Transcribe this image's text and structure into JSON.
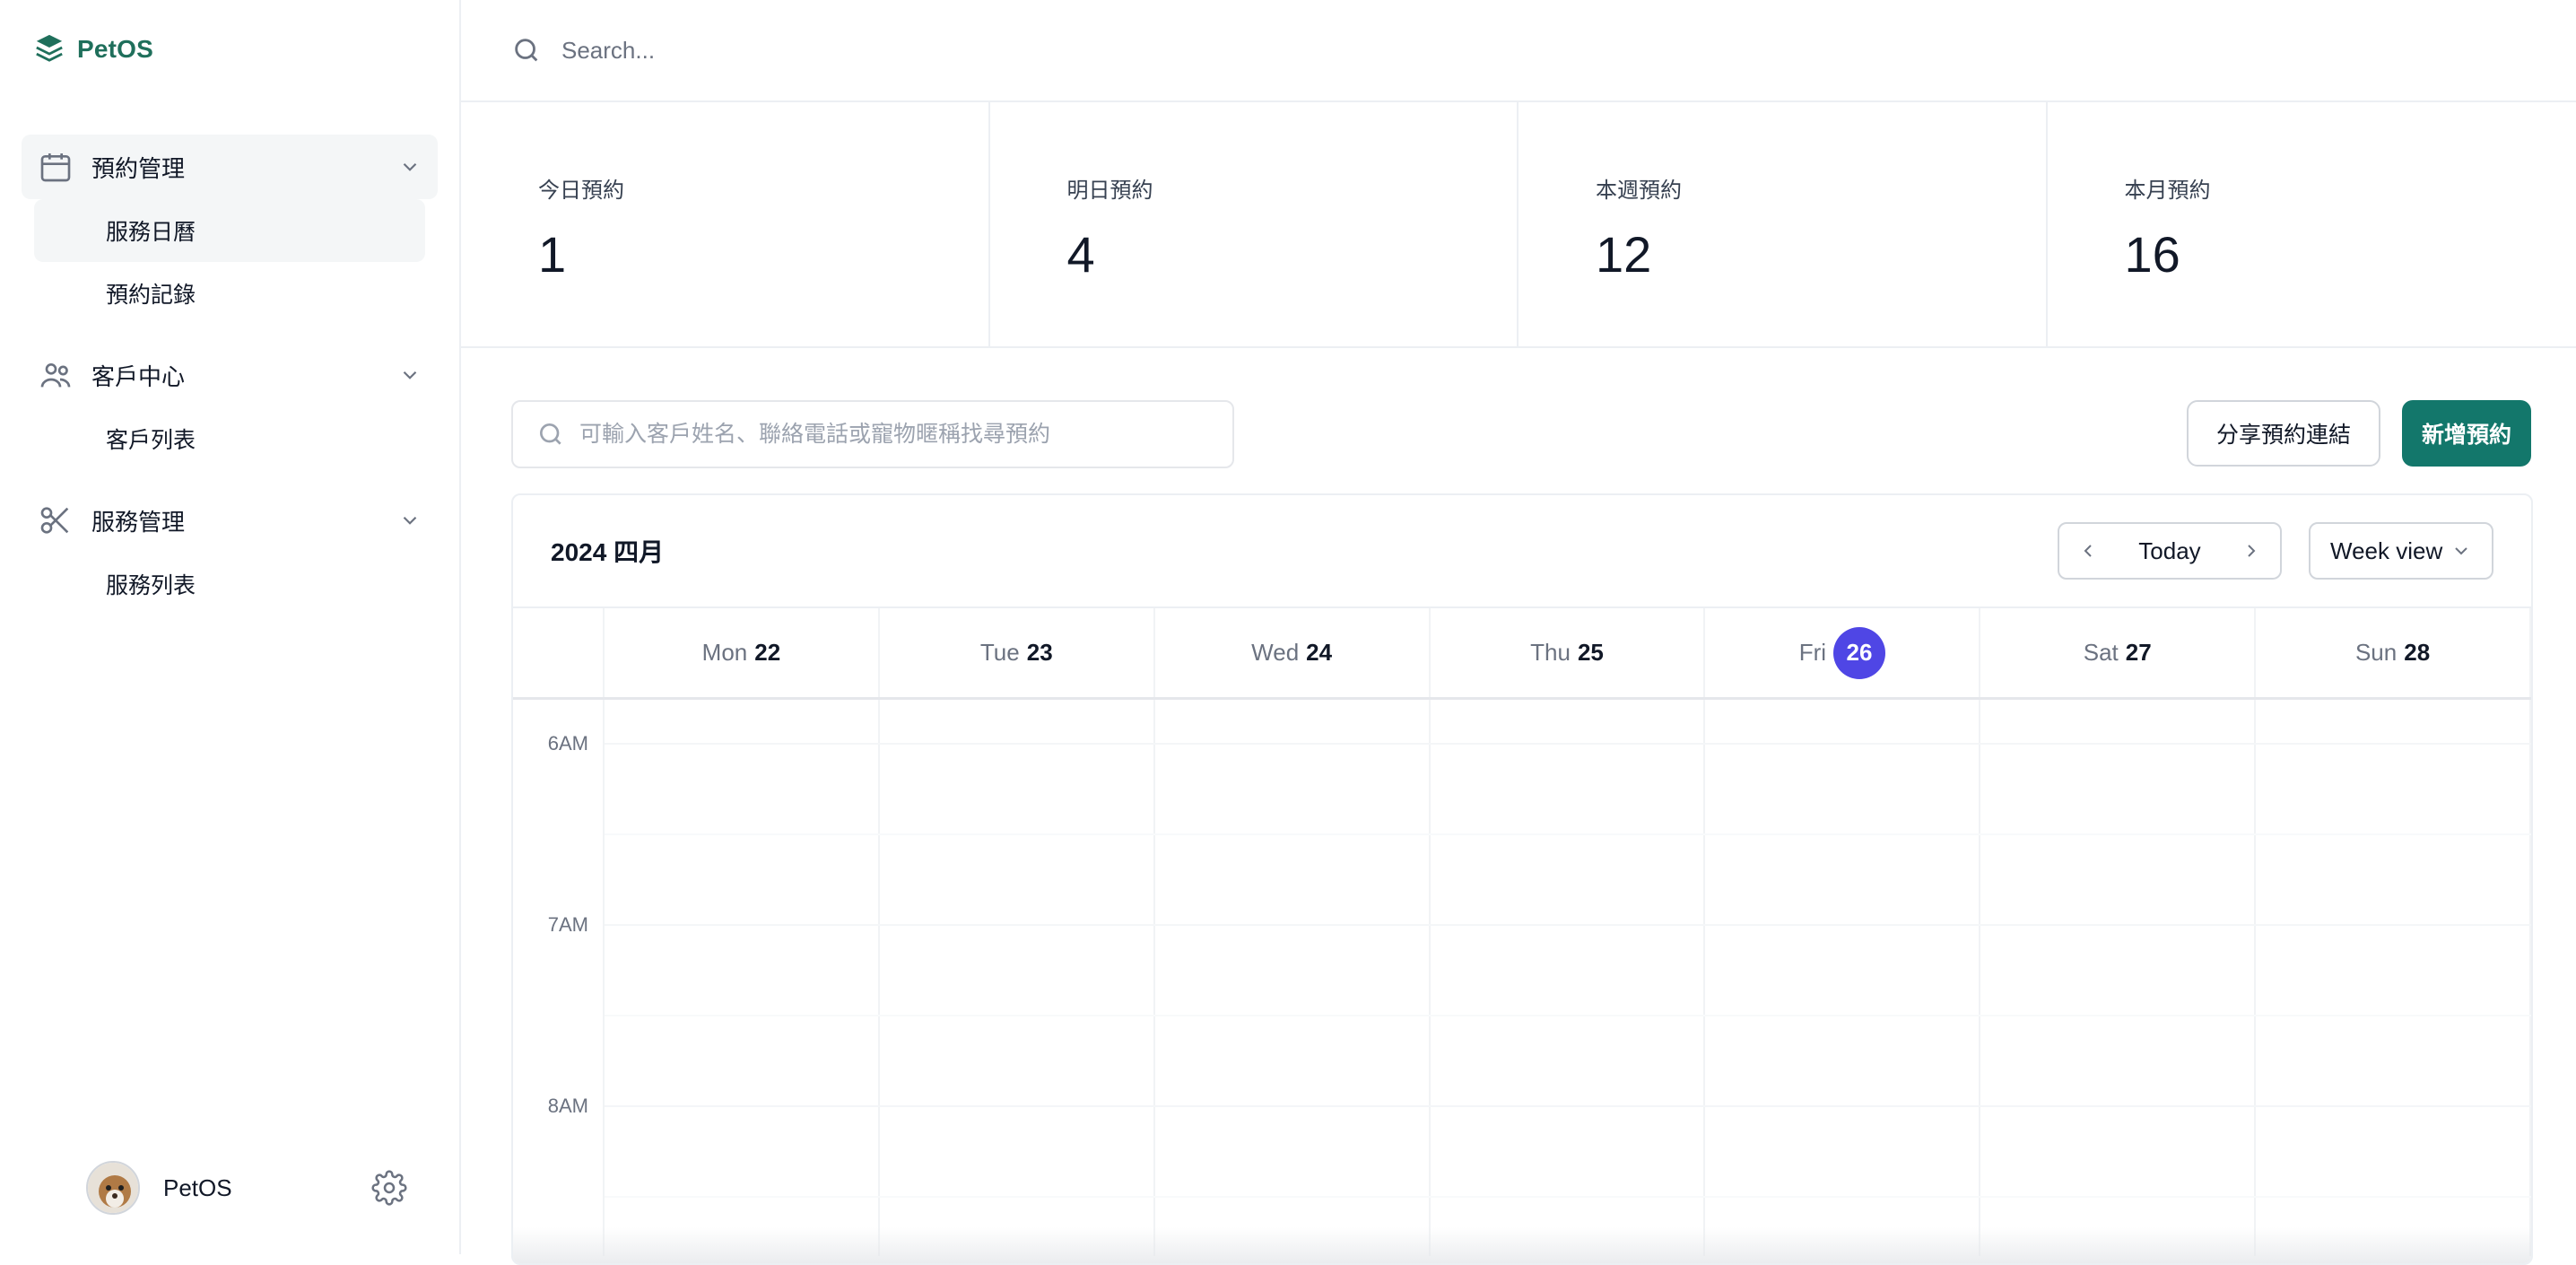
{
  "brand": {
    "name": "PetOS",
    "color": "#1f6f5b"
  },
  "top_search": {
    "placeholder": "Search..."
  },
  "sidebar": {
    "groups": [
      {
        "label": "預約管理",
        "items": [
          "服務日曆",
          "預約記錄"
        ]
      },
      {
        "label": "客戶中心",
        "items": [
          "客戶列表"
        ]
      },
      {
        "label": "服務管理",
        "items": [
          "服務列表"
        ]
      }
    ],
    "active_item": "服務日曆",
    "footer": {
      "name": "PetOS"
    }
  },
  "stats": [
    {
      "label": "今日預約",
      "value": "1"
    },
    {
      "label": "明日預約",
      "value": "4"
    },
    {
      "label": "本週預約",
      "value": "12"
    },
    {
      "label": "本月預約",
      "value": "16"
    }
  ],
  "appointment_search": {
    "placeholder": "可輸入客戶姓名、聯絡電話或寵物暱稱找尋預約"
  },
  "actions": {
    "share_label": "分享預約連結",
    "new_label": "新增預約",
    "primary_color": "#13776b"
  },
  "calendar": {
    "title": "2024 四月",
    "today_label": "Today",
    "view_label": "Week view",
    "days": [
      {
        "name": "Mon",
        "date": "22"
      },
      {
        "name": "Tue",
        "date": "23"
      },
      {
        "name": "Wed",
        "date": "24"
      },
      {
        "name": "Thu",
        "date": "25"
      },
      {
        "name": "Fri",
        "date": "26",
        "today": true
      },
      {
        "name": "Sat",
        "date": "27"
      },
      {
        "name": "Sun",
        "date": "28"
      }
    ],
    "times": [
      "6AM",
      "7AM",
      "8AM"
    ],
    "today_color": "#4f46e5"
  }
}
